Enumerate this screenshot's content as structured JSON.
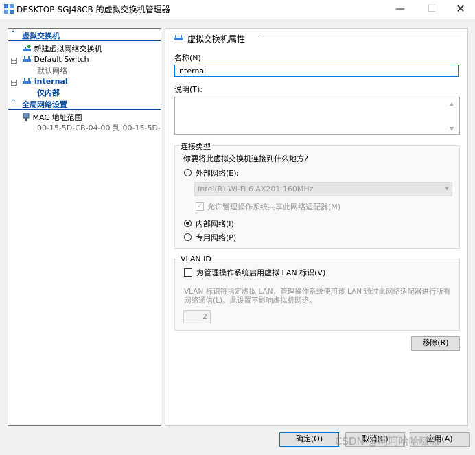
{
  "window": {
    "title": "DESKTOP-SGJ48CB 的虚拟交换机管理器",
    "minimize": "—",
    "maximize": "☐",
    "close": "✕"
  },
  "tree": {
    "section_switches": "虚拟交换机",
    "new_switch": "新建虚拟网络交换机",
    "default_switch": {
      "name": "Default Switch",
      "sub": "默认网络"
    },
    "internal_switch": {
      "name": "internal",
      "sub": "仅内部"
    },
    "section_global": "全局网络设置",
    "mac_range": {
      "name": "MAC 地址范围",
      "sub": "00-15-5D-CB-04-00 到 00-15-5D-..."
    }
  },
  "properties": {
    "title": "虚拟交换机属性",
    "name_label": "名称(N):",
    "name_value": "internal",
    "notes_label": "说明(T):",
    "connection": {
      "group_label": "连接类型",
      "question": "你要将此虚拟交换机连接到什么地方?",
      "external_label": "外部网络(E):",
      "adapter": "Intel(R) Wi-Fi 6 AX201 160MHz",
      "allow_mgmt": "允许管理操作系统共享此网络适配器(M)",
      "internal_label": "内部网络(I)",
      "private_label": "专用网络(P)",
      "selected": "internal"
    },
    "vlan": {
      "group_label": "VLAN ID",
      "enable_label": "为管理操作系统启用虚拟 LAN 标识(V)",
      "description": "VLAN 标识符指定虚拟 LAN，管理操作系统使用该 LAN 通过此网络适配器进行所有网络通信(L)。此设置不影响虚拟机网络。",
      "id_value": "2"
    },
    "remove_button": "移除(R)"
  },
  "footer": {
    "ok": "确定(O)",
    "cancel": "取消(C)",
    "apply": "应用(A)"
  },
  "watermark": "CSDN @呵呵哈哈嗷嗷",
  "colors": {
    "accent": "#0b4ea8",
    "focus": "#0078d7"
  }
}
